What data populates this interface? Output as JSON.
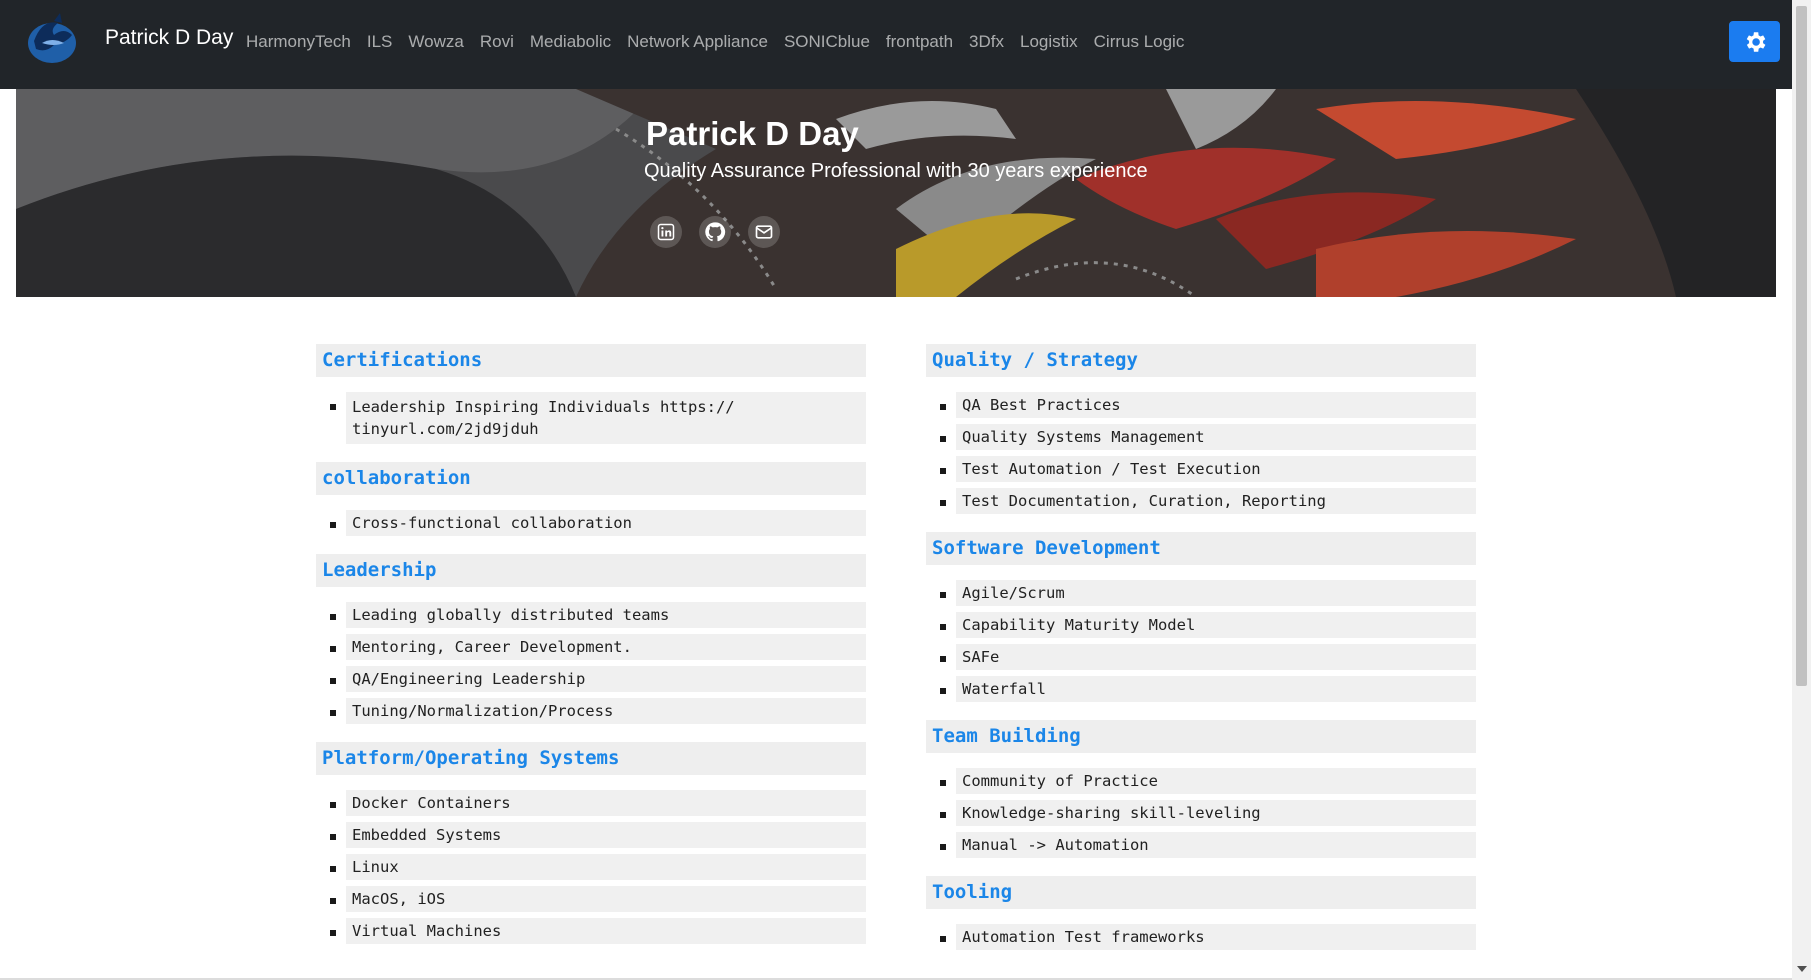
{
  "navbar": {
    "brand": "Patrick D Day",
    "links": [
      "HarmonyTech",
      "ILS",
      "Wowza",
      "Rovi",
      "Mediabolic",
      "Network Appliance",
      "SONICblue",
      "frontpath",
      "3Dfx",
      "Logistix",
      "Cirrus Logic"
    ],
    "settings_icon": "gear-icon",
    "accent_color": "#1b7cf0"
  },
  "hero": {
    "title": "Patrick D Day",
    "subtitle": "Quality Assurance Professional with 30 years experience",
    "social_icons": [
      "linkedin-icon",
      "github-icon",
      "mail-icon"
    ]
  },
  "left_column": [
    {
      "title": "Certifications",
      "items": [
        "Leadership Inspiring Individuals https:// tinyurl.com/2jd9jduh"
      ]
    },
    {
      "title": "collaboration",
      "items": [
        "Cross-functional collaboration"
      ]
    },
    {
      "title": "Leadership",
      "items": [
        "Leading globally distributed teams",
        "Mentoring, Career Development.",
        "QA/Engineering Leadership",
        "Tuning/Normalization/Process"
      ]
    },
    {
      "title": "Platform/Operating Systems",
      "items": [
        "Docker Containers",
        "Embedded Systems",
        "Linux",
        "MacOS, iOS",
        "Virtual Machines"
      ]
    }
  ],
  "right_column": [
    {
      "title": "Quality / Strategy",
      "items": [
        "QA Best Practices",
        "Quality Systems Management",
        "Test Automation / Test Execution",
        "Test Documentation, Curation, Reporting"
      ]
    },
    {
      "title": "Software Development",
      "items": [
        "Agile/Scrum",
        "Capability Maturity Model",
        "SAFe",
        "Waterfall"
      ]
    },
    {
      "title": "Team Building",
      "items": [
        "Community of Practice",
        "Knowledge-sharing skill-leveling",
        "Manual -> Automation"
      ]
    },
    {
      "title": "Tooling",
      "items": [
        "Automation Test frameworks"
      ]
    }
  ],
  "colors": {
    "section_title": "#1b86e8",
    "navbar_bg": "#212529",
    "section_bg": "#eeeeee"
  }
}
